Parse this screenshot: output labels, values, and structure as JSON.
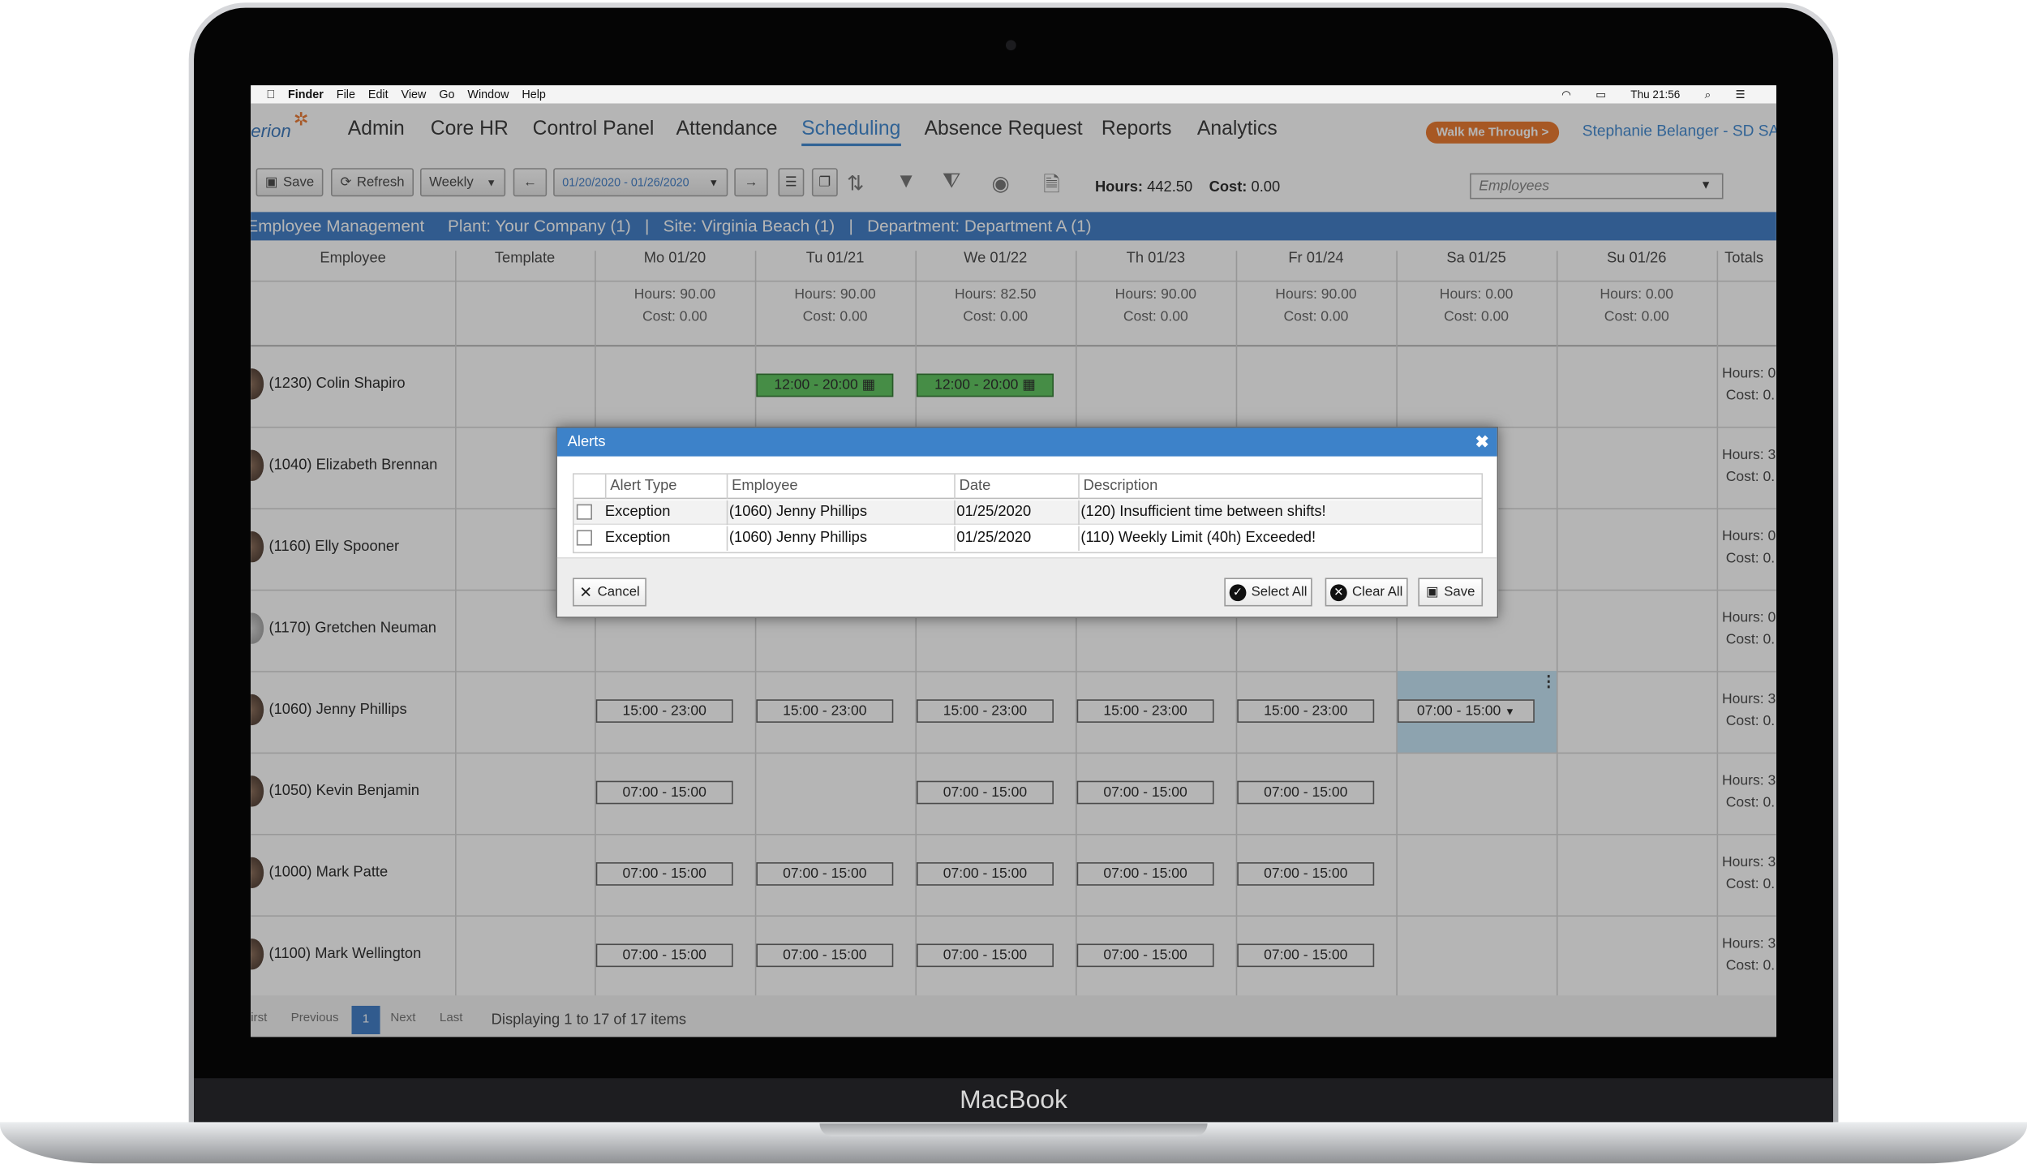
{
  "device": {
    "brand": "MacBook"
  },
  "menubar": {
    "apple": "",
    "items": [
      "Finder",
      "File",
      "Edit",
      "View",
      "Go",
      "Window",
      "Help"
    ],
    "clock": "Thu 21:56"
  },
  "app": {
    "logo": "erion",
    "nav": [
      "Admin",
      "Core HR",
      "Control Panel",
      "Attendance",
      "Scheduling",
      "Absence Request",
      "Reports",
      "Analytics"
    ],
    "active_nav": "Scheduling",
    "walk_me": "Walk Me Through >",
    "user": "Stephanie Belanger - SD SAL"
  },
  "toolbar": {
    "save": "Save",
    "refresh": "Refresh",
    "view": "Weekly",
    "date_range": "01/20/2020 - 01/26/2020",
    "hours_label": "Hours:",
    "hours_value": "442.50",
    "cost_label": "Cost:",
    "cost_value": "0.00",
    "employees_placeholder": "Employees"
  },
  "breadcrumb": "Employee Management     Plant: Your Company (1)   |   Site: Virginia Beach (1)   |   Department: Department A (1)",
  "grid": {
    "headers": [
      "Employee",
      "Template",
      "Mo 01/20",
      "Tu 01/21",
      "We 01/22",
      "Th 01/23",
      "Fr 01/24",
      "Sa 01/25",
      "Su 01/26",
      "Totals"
    ],
    "day_summaries": [
      {
        "hours": "Hours: 90.00",
        "cost": "Cost: 0.00"
      },
      {
        "hours": "Hours: 90.00",
        "cost": "Cost: 0.00"
      },
      {
        "hours": "Hours: 82.50",
        "cost": "Cost: 0.00"
      },
      {
        "hours": "Hours: 90.00",
        "cost": "Cost: 0.00"
      },
      {
        "hours": "Hours: 90.00",
        "cost": "Cost: 0.00"
      },
      {
        "hours": "Hours: 0.00",
        "cost": "Cost: 0.00"
      },
      {
        "hours": "Hours: 0.00",
        "cost": "Cost: 0.00"
      }
    ],
    "rows": [
      {
        "name": "(1230) Colin Shapiro",
        "tot_h": "Hours: 0",
        "tot_c": "Cost: 0."
      },
      {
        "name": "(1040) Elizabeth Brennan",
        "tot_h": "Hours: 3",
        "tot_c": "Cost: 0."
      },
      {
        "name": "(1160) Elly Spooner",
        "tot_h": "Hours: 0",
        "tot_c": "Cost: 0."
      },
      {
        "name": "(1170) Gretchen Neuman",
        "tot_h": "Hours: 0",
        "tot_c": "Cost: 0."
      },
      {
        "name": "(1060) Jenny Phillips",
        "tot_h": "Hours: 3",
        "tot_c": "Cost: 0."
      },
      {
        "name": "(1050) Kevin Benjamin",
        "tot_h": "Hours: 3",
        "tot_c": "Cost: 0."
      },
      {
        "name": "(1000) Mark Patte",
        "tot_h": "Hours: 3",
        "tot_c": "Cost: 0."
      },
      {
        "name": "(1100) Mark Wellington",
        "tot_h": "Hours: 3",
        "tot_c": "Cost: 0."
      }
    ],
    "shifts": {
      "colin_tu": "12:00 - 20:00",
      "colin_we": "12:00 - 20:00",
      "late": "15:00 - 23:00",
      "early": "07:00 - 15:00"
    }
  },
  "pager": {
    "first": "irst",
    "previous": "Previous",
    "page": "1",
    "next": "Next",
    "last": "Last",
    "info": "Displaying 1 to 17 of 17 items"
  },
  "alerts": {
    "title": "Alerts",
    "columns": [
      "Alert Type",
      "Employee",
      "Date",
      "Description"
    ],
    "rows": [
      {
        "type": "Exception",
        "employee": "(1060) Jenny Phillips",
        "date": "01/25/2020",
        "description": "(120) Insufficient time between shifts!"
      },
      {
        "type": "Exception",
        "employee": "(1060) Jenny Phillips",
        "date": "01/25/2020",
        "description": "(110) Weekly Limit (40h) Exceeded!"
      }
    ],
    "cancel": "Cancel",
    "select_all": "Select All",
    "clear_all": "Clear All",
    "save": "Save"
  },
  "colors": {
    "accent": "#2a6fc0",
    "walk_me": "#e96a16",
    "shift_green": "#4cbf4c"
  }
}
